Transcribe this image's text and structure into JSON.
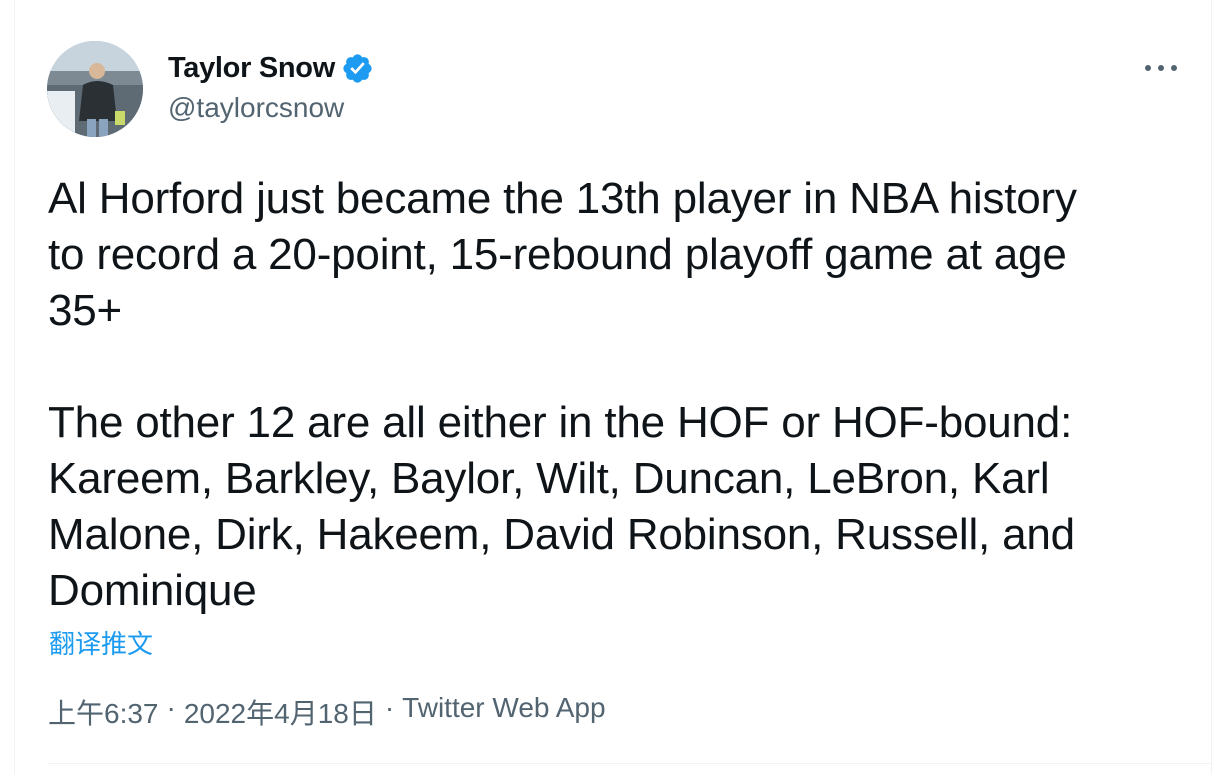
{
  "author": {
    "name": "Taylor Snow",
    "handle": "@taylorcsnow",
    "verified": true,
    "avatar_icon": "user-photo-avatar"
  },
  "tweet": {
    "text": "Al Horford just became the 13th player in NBA history\nto record a 20-point, 15-rebound playoff game at age\n35+\n\nThe other 12 are all either in the HOF or HOF-bound:\nKareem, Barkley, Baylor, Wilt, Duncan, LeBron, Karl\nMalone, Dirk, Hakeem, David Robinson, Russell, and\nDominique",
    "translate_label": "翻译推文",
    "time": "上午6:37",
    "date": "2022年4月18日",
    "source": "Twitter Web App",
    "separator": "·"
  },
  "icons": {
    "verified": "verified-badge-icon",
    "more": "more-options-icon"
  },
  "colors": {
    "accent": "#1d9bf0",
    "text": "#0f1419",
    "secondary": "#536471"
  }
}
